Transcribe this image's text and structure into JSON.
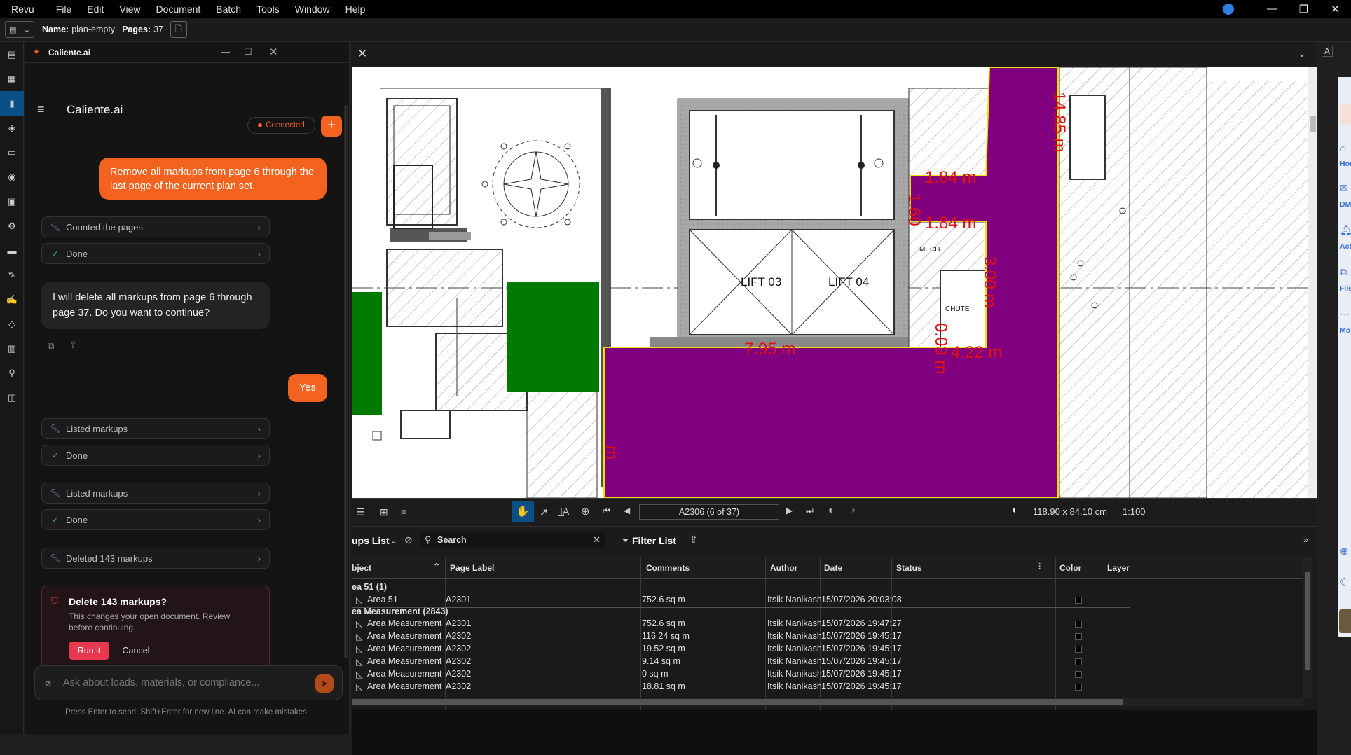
{
  "menu": [
    "Revu",
    "File",
    "Edit",
    "View",
    "Document",
    "Batch",
    "Tools",
    "Window",
    "Help"
  ],
  "docinfo": {
    "name_label": "Name:",
    "name_value": "plan-empty",
    "pages_label": "Pages:",
    "pages_value": "37"
  },
  "chat": {
    "window_title": "Caliente.ai",
    "header_title": "Caliente.ai",
    "status": "Connected",
    "msg_user_1": "Remove all markups from page 6 through the last page of the current plan set.",
    "step_counted": "Counted the pages",
    "step_done_1": "Done",
    "msg_assistant_1": "I will delete all markups from page 6 through page 37. Do you want to continue?",
    "msg_user_2": "Yes",
    "step_listed_1": "Listed markups",
    "step_done_2": "Done",
    "step_listed_2": "Listed markups",
    "step_done_3": "Done",
    "step_deleted": "Deleted 143 markups",
    "confirm_title": "Delete 143 markups?",
    "confirm_body": "This changes your open document. Review before continuing.",
    "confirm_run": "Run it",
    "confirm_cancel": "Cancel",
    "input_placeholder": "Ask about loads, materials, or compliance...",
    "footer_hint": "Press Enter to send, Shift+Enter for new line. AI can make mistakes."
  },
  "drawing": {
    "lift_a": "LIFT 03",
    "lift_b": "LIFT 04",
    "mech": "MECH",
    "chute": "CHUTE",
    "dim_1": "7.95 m",
    "dim_2": "1.84 m",
    "dim_3": "1.84 m",
    "dim_4": "3.00 m",
    "dim_5": "4.22 m",
    "dim_6": "14.85 m",
    "dim_7": "1.60",
    "dim_8": "0.03 m",
    "dim_9": "m"
  },
  "doctools": {
    "page_label": "A2306 (6 of 37)",
    "page_size": "118.90 x 84.10 cm",
    "scale": "1:100"
  },
  "markups_list": {
    "title": "ups List",
    "search_placeholder": "Search",
    "filter_label": "Filter List",
    "columns": [
      "bject",
      "Page Label",
      "Comments",
      "Author",
      "Date",
      "Status",
      "Color",
      "Layer"
    ],
    "groups": [
      {
        "label": "ea 51 (1)",
        "rows": [
          [
            "Area 51",
            "A2301",
            "752.6 sq m",
            "Itsik Nanikash...",
            "15/07/2026 20:03:08"
          ]
        ]
      },
      {
        "label": "ea Measurement (2843)",
        "rows": [
          [
            "Area Measurement",
            "A2301",
            "752.6 sq m",
            "Itsik Nanikash...",
            "15/07/2026 19:47:27"
          ],
          [
            "Area Measurement",
            "A2302",
            "116.24 sq m",
            "Itsik Nanikash...",
            "15/07/2026 19:45:17"
          ],
          [
            "Area Measurement",
            "A2302",
            "19.52 sq m",
            "Itsik Nanikash...",
            "15/07/2026 19:45:17"
          ],
          [
            "Area Measurement",
            "A2302",
            "9.14 sq m",
            "Itsik Nanikash...",
            "15/07/2026 19:45:17"
          ],
          [
            "Area Measurement",
            "A2302",
            "0 sq m",
            "Itsik Nanikash...",
            "15/07/2026 19:45:17"
          ],
          [
            "Area Measurement",
            "A2302",
            "18.81 sq m",
            "Itsik Nanikash...",
            "15/07/2026 19:45:17"
          ]
        ]
      }
    ]
  },
  "rail": [
    "Hom",
    "DMs",
    "Activi",
    "Files",
    "Mor"
  ],
  "colors": {
    "accent": "#f4621f",
    "purple": "#800080",
    "green": "#007a00",
    "dim_red": "#e01010",
    "active_blue": "#0a4f86",
    "confirm_red": "#e8384f"
  }
}
